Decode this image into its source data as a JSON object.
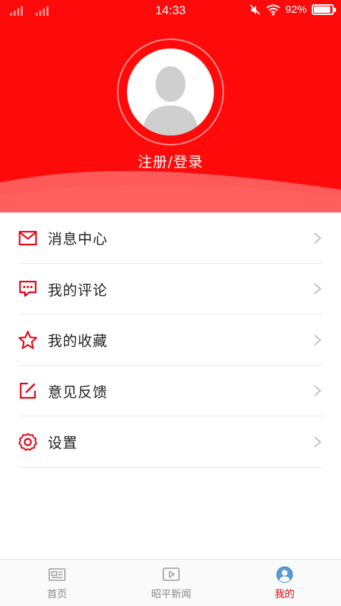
{
  "status_bar": {
    "time": "14:33",
    "battery_text": "92%",
    "battery_level": 0.92
  },
  "profile": {
    "login_label": "注册/登录"
  },
  "menu": {
    "items": [
      {
        "label": "消息中心",
        "icon": "mail-icon"
      },
      {
        "label": "我的评论",
        "icon": "comment-icon"
      },
      {
        "label": "我的收藏",
        "icon": "star-icon"
      },
      {
        "label": "意见反馈",
        "icon": "edit-icon"
      },
      {
        "label": "设置",
        "icon": "gear-icon"
      }
    ]
  },
  "bottom_nav": {
    "items": [
      {
        "label": "首页",
        "icon": "newspaper-icon",
        "active": false
      },
      {
        "label": "昭平新闻",
        "icon": "play-icon",
        "active": false
      },
      {
        "label": "我的",
        "icon": "user-icon",
        "active": true
      }
    ]
  },
  "colors": {
    "brand_red": "#ff0a0a",
    "icon_red": "#e60012",
    "inactive_gray": "#8a8a8a"
  }
}
